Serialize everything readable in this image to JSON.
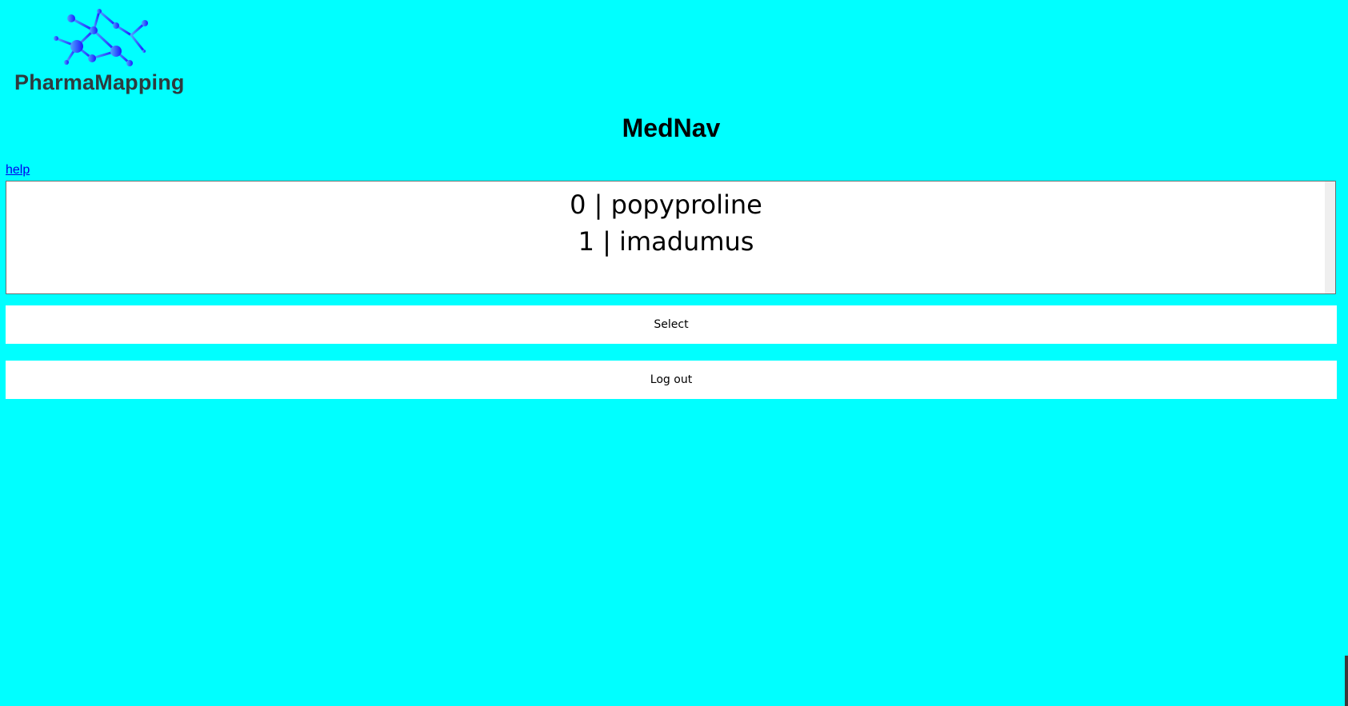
{
  "logo": {
    "text": "PharmaMapping",
    "icon": "molecule-network-icon"
  },
  "page": {
    "title": "MedNav",
    "help_link": "help"
  },
  "list": {
    "items": [
      {
        "label": "0 | popyproline"
      },
      {
        "label": "1 | imadumus"
      }
    ]
  },
  "buttons": {
    "select": "Select",
    "logout": "Log out"
  },
  "colors": {
    "background": "#00ffff",
    "logo_text": "#2e3b3e",
    "link": "#0000ee"
  }
}
